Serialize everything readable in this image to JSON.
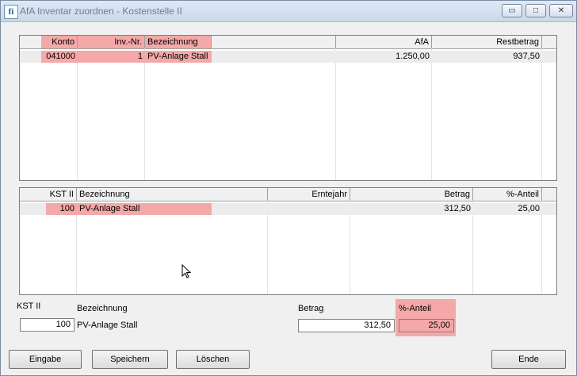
{
  "window": {
    "title": "AfA Inventar zuordnen - Kostenstelle II",
    "icon_text": "fi"
  },
  "titlebar_buttons": [
    "minimize-icon",
    "maximize-icon",
    "close-icon"
  ],
  "top_grid": {
    "headers": {
      "konto": "Konto",
      "invnr": "Inv.-Nr.",
      "bez": "Bezeichnung",
      "afa": "AfA",
      "rest": "Restbetrag"
    },
    "rows": [
      {
        "konto": "041000",
        "invnr": "1",
        "bez": "PV-Anlage Stall",
        "afa": "1.250,00",
        "rest": "937,50"
      }
    ]
  },
  "bottom_grid": {
    "headers": {
      "kst": "KST II",
      "bez": "Bezeichnung",
      "ernte": "Erntejahr",
      "betrag": "Betrag",
      "anteil": "%-Anteil"
    },
    "rows": [
      {
        "kst": "100",
        "bez": "PV-Anlage Stall",
        "ernte": "",
        "betrag": "312,50",
        "anteil": "25,00"
      }
    ]
  },
  "form": {
    "kst_label": "KST II",
    "kst_value": "100",
    "bez_label": "Bezeichnung",
    "bez_value": "PV-Anlage Stall",
    "betrag_label": "Betrag",
    "betrag_value": "312,50",
    "anteil_label": "%-Anteil",
    "anteil_value": "25,00"
  },
  "buttons": {
    "eingabe": "Eingabe",
    "speichern": "Speichern",
    "loeschen": "Löschen",
    "ende": "Ende"
  },
  "colors": {
    "highlight": "#f4a8a8",
    "row_bg": "#ececec"
  }
}
